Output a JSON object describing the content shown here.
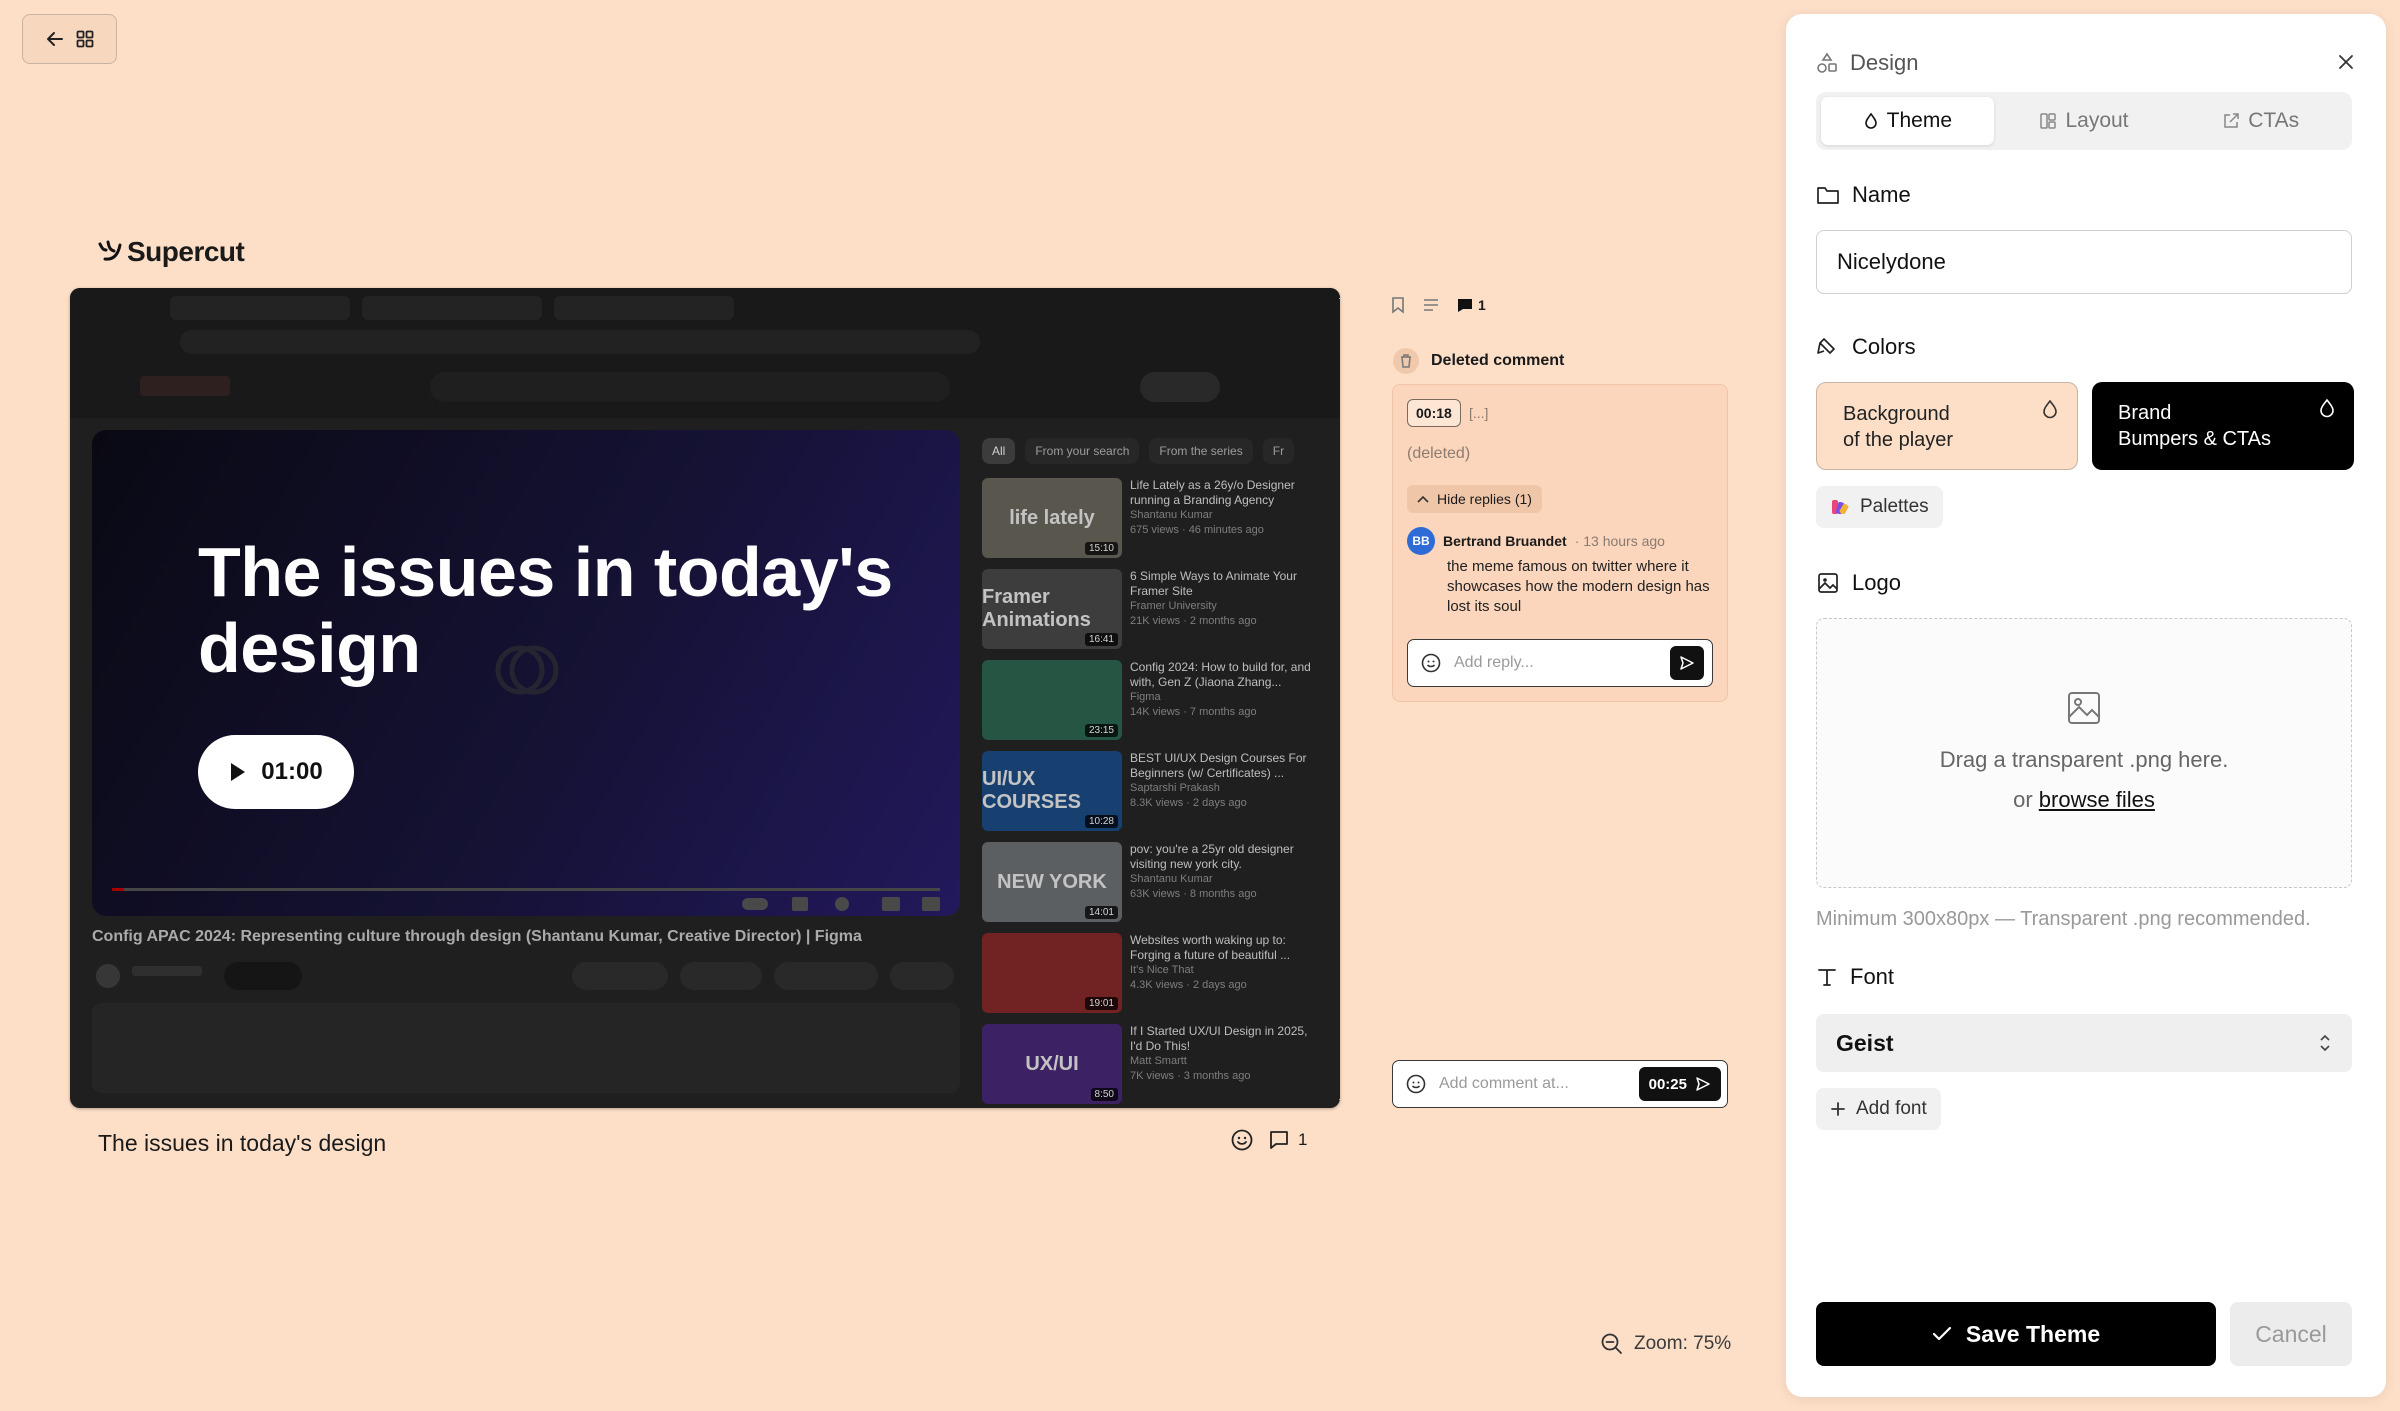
{
  "brand": {
    "name": "Supercut"
  },
  "video": {
    "player_title": "The issues in today's design",
    "play_duration": "01:00",
    "caption": "The issues in today's design",
    "comment_count": "1",
    "yt_page_title": "Config APAC 2024: Representing culture through design (Shantanu Kumar, Creative Director) | Figma",
    "yt_chips": [
      "All",
      "From your search",
      "From the series",
      "Fr"
    ],
    "yt_list": [
      {
        "title": "Life Lately as a 26y/o Designer running a Branding Agency",
        "channel": "Shantanu Kumar",
        "meta": "675 views · 46 minutes ago",
        "thumb": "life lately",
        "duration": "15:10",
        "color": "#6d6a5f"
      },
      {
        "title": "6 Simple Ways to Animate Your Framer Site",
        "channel": "Framer University",
        "meta": "21K views · 2 months ago",
        "thumb": "Framer Animations",
        "duration": "16:41",
        "color": "#4b4b4b"
      },
      {
        "title": "Config 2024: How to build for, and with, Gen Z (Jiaona Zhang...",
        "channel": "Figma",
        "meta": "14K views · 7 months ago",
        "thumb": "",
        "duration": "23:15",
        "color": "#2c6a52"
      },
      {
        "title": "BEST UI/UX Design Courses For Beginners (w/ Certificates) ...",
        "channel": "Saptarshi Prakash",
        "meta": "8.3K views · 2 days ago",
        "thumb": "UI/UX COURSES",
        "duration": "10:28",
        "color": "#1d4f8a"
      },
      {
        "title": "pov: you're a 25yr old designer visiting new york city.",
        "channel": "Shantanu Kumar",
        "meta": "63K views · 8 months ago",
        "thumb": "NEW YORK",
        "duration": "14:01",
        "color": "#6f7477"
      },
      {
        "title": "Websites worth waking up to: Forging a future of beautiful ...",
        "channel": "It's Nice That",
        "meta": "4.3K views · 2 days ago",
        "thumb": "",
        "duration": "19:01",
        "color": "#8a2a2a"
      },
      {
        "title": "If I Started UX/UI Design in 2025, I'd Do This!",
        "channel": "Matt Smartt",
        "meta": "7K views · 3 months ago",
        "thumb": "UX/UI",
        "duration": "8:50",
        "color": "#4a2a7a"
      }
    ]
  },
  "comments": {
    "toolbar_count": "1",
    "deleted_heading": "Deleted comment",
    "timestamp": "00:18",
    "timestamp_rest": "[...]",
    "deleted_text": "(deleted)",
    "hide_replies": "Hide replies (1)",
    "reply": {
      "initials": "BB",
      "author": "Bertrand Bruandet",
      "time": "· 13 hours ago",
      "text": "the meme famous on twitter where it showcases how the modern design has lost its soul"
    },
    "reply_placeholder": "Add reply...",
    "add_placeholder": "Add comment at...",
    "add_timestamp": "00:25"
  },
  "zoom": {
    "label": "Zoom: 75%"
  },
  "panel": {
    "title": "Design",
    "tabs": [
      {
        "label": "Theme",
        "active": true
      },
      {
        "label": "Layout",
        "active": false
      },
      {
        "label": "CTAs",
        "active": false
      }
    ],
    "name_label": "Name",
    "name_value": "Nicelydone",
    "colors_label": "Colors",
    "color_bg": {
      "title": "Background",
      "sub": "of the player",
      "hex": "#fddfc8"
    },
    "color_brand": {
      "title": "Brand",
      "sub": "Bumpers & CTAs",
      "hex": "#000000"
    },
    "palettes_label": "Palettes",
    "logo_label": "Logo",
    "drop_line1": "Drag a transparent .png here.",
    "drop_or": "or",
    "drop_link": "browse files",
    "logo_hint": "Minimum 300x80px — Transparent .png recommended.",
    "font_label": "Font",
    "font_value": "Geist",
    "add_font_label": "Add font",
    "save_label": "Save Theme",
    "cancel_label": "Cancel"
  }
}
